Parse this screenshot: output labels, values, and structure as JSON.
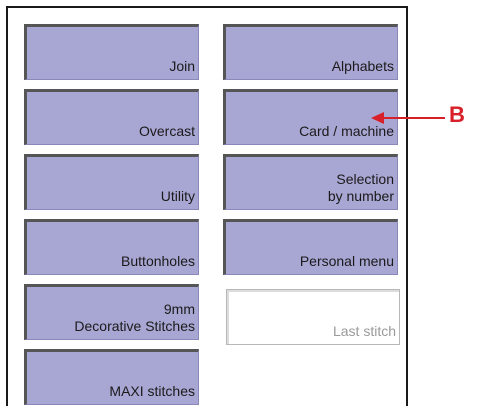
{
  "menu": {
    "left": [
      {
        "id": "join",
        "label": "Join"
      },
      {
        "id": "overcast",
        "label": "Overcast"
      },
      {
        "id": "utility",
        "label": "Utility"
      },
      {
        "id": "buttonholes",
        "label": "Buttonholes"
      },
      {
        "id": "decorative",
        "label": "9mm\nDecorative Stitches"
      },
      {
        "id": "maxi",
        "label": "MAXI stitches"
      }
    ],
    "right": [
      {
        "id": "alphabets",
        "label": "Alphabets"
      },
      {
        "id": "card-machine",
        "label": "Card / machine"
      },
      {
        "id": "selection",
        "label": "Selection\nby number"
      },
      {
        "id": "personal",
        "label": "Personal menu"
      },
      {
        "id": "last-stitch",
        "label": "Last stitch",
        "empty": true
      }
    ]
  },
  "callout": {
    "letter": "B",
    "color": "#d8202a"
  },
  "colors": {
    "button_face": "#a8a6d3",
    "button_shadow": "#555555"
  }
}
